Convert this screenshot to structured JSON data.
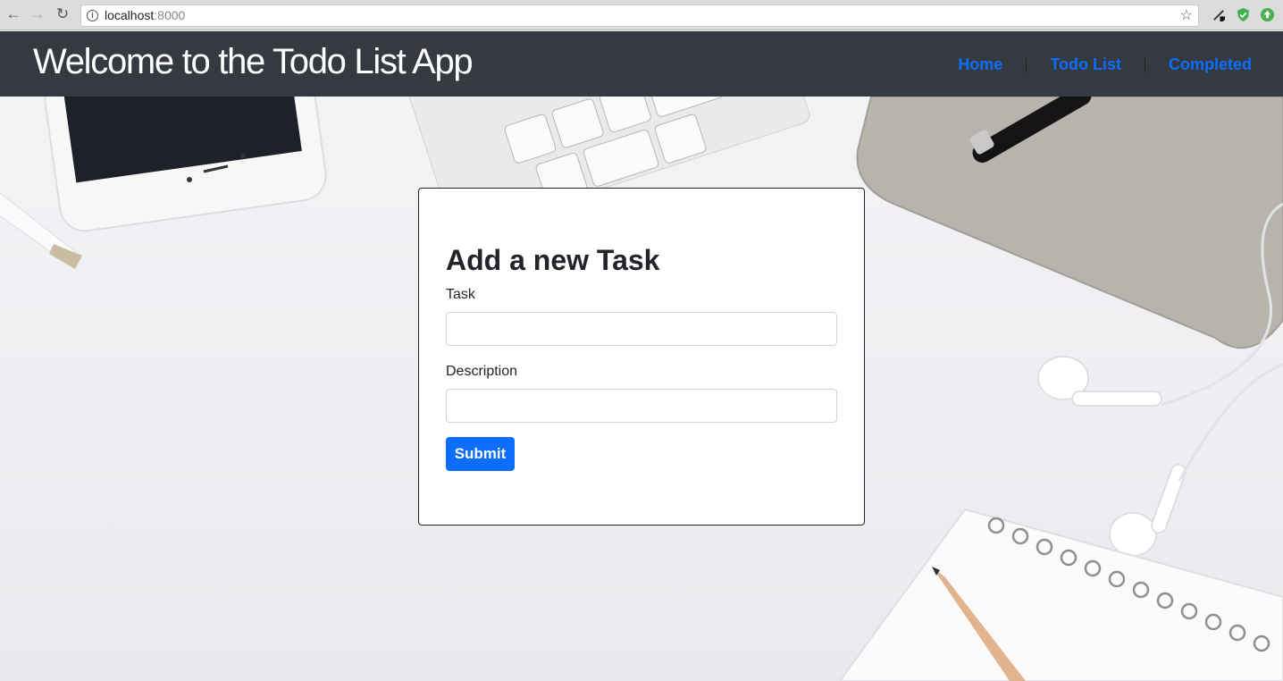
{
  "browser": {
    "url_host": "localhost",
    "url_port": ":8000"
  },
  "header": {
    "title": "Welcome to the Todo List App",
    "nav": [
      {
        "label": "Home"
      },
      {
        "label": "Todo List"
      },
      {
        "label": "Completed"
      }
    ]
  },
  "form": {
    "title": "Add a new Task",
    "task_label": "Task",
    "task_value": "",
    "description_label": "Description",
    "description_value": "",
    "submit_label": "Submit"
  },
  "colors": {
    "header_bg": "#343a40",
    "link": "#0d6efd",
    "button": "#0d6efd"
  },
  "icons": [
    "back-icon",
    "forward-icon",
    "reload-icon",
    "info-icon",
    "star-icon",
    "extension-icon",
    "shield-icon",
    "upload-icon"
  ]
}
